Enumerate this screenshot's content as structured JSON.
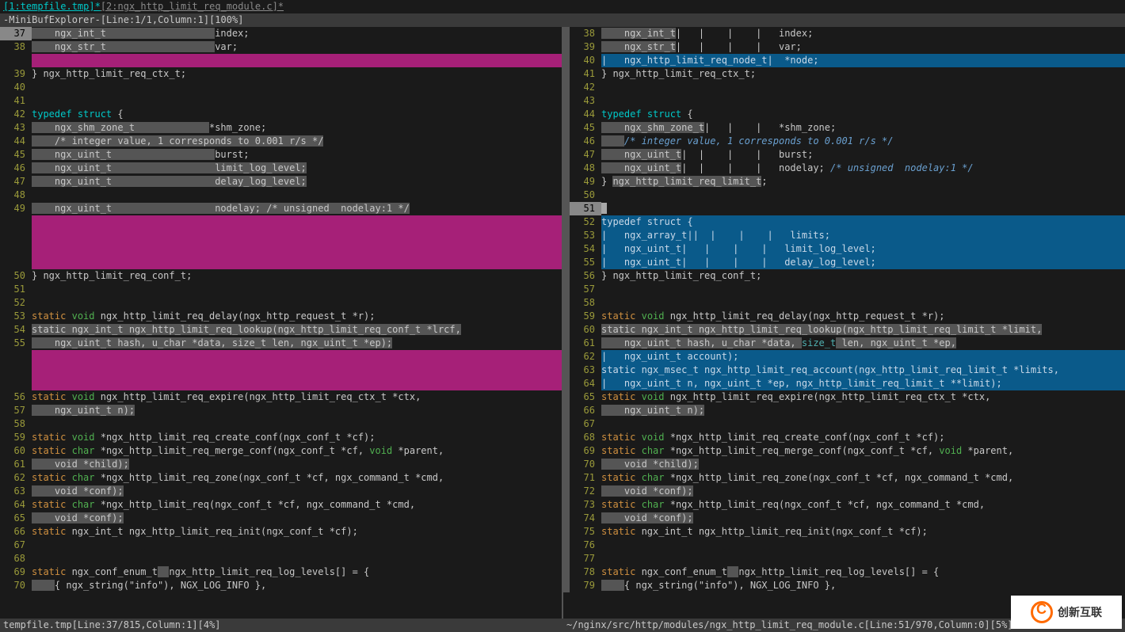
{
  "tabline": {
    "tab1": "[1:tempfile.tmp]*",
    "tab2": "[2:ngx_http_limit_req_module.c]*"
  },
  "minibuf": "-MiniBufExplorer-[Line:1/1,Column:1][100%]",
  "status_left": "tempfile.tmp[Line:37/815,Column:1][4%]",
  "status_right": "~/nginx/src/http/modules/ngx_http_limit_req_module.c[Line:51/970,Column:0][5%]",
  "logo_text": "创新互联",
  "left": [
    {
      "n": "37",
      "cls": "cur",
      "seg": [
        {
          "t": "    ngx_int_t                   ",
          "c": "hl-gray"
        },
        {
          "t": "index;",
          "c": ""
        }
      ]
    },
    {
      "n": "38",
      "seg": [
        {
          "t": "    ngx_str_t                   ",
          "c": "hl-gray"
        },
        {
          "t": "var;",
          "c": ""
        }
      ]
    },
    {
      "n": "",
      "mag": true
    },
    {
      "n": "39",
      "seg": [
        {
          "t": "} ngx_http_limit_req_ctx_t;",
          "c": ""
        }
      ]
    },
    {
      "n": "40",
      "seg": [
        {
          "t": "",
          "c": ""
        }
      ]
    },
    {
      "n": "41",
      "seg": [
        {
          "t": "",
          "c": ""
        }
      ]
    },
    {
      "n": "42",
      "seg": [
        {
          "t": "typedef",
          "c": "hl-kw"
        },
        {
          "t": " ",
          "c": ""
        },
        {
          "t": "struct",
          "c": "hl-kw"
        },
        {
          "t": " {",
          "c": ""
        }
      ]
    },
    {
      "n": "43",
      "seg": [
        {
          "t": "    ngx_shm_zone_t             ",
          "c": "hl-gray"
        },
        {
          "t": "*shm_zone;",
          "c": ""
        }
      ]
    },
    {
      "n": "44",
      "seg": [
        {
          "t": "    /* integer value, 1 corresponds to 0.001 r/s */",
          "c": "hl-gray"
        }
      ]
    },
    {
      "n": "45",
      "seg": [
        {
          "t": "    ngx_uint_t                  ",
          "c": "hl-gray"
        },
        {
          "t": "burst;",
          "c": ""
        }
      ]
    },
    {
      "n": "46",
      "seg": [
        {
          "t": "    ngx_uint_t                  limit_log_level;",
          "c": "hl-gray"
        }
      ]
    },
    {
      "n": "47",
      "seg": [
        {
          "t": "    ngx_uint_t                  delay_log_level;",
          "c": "hl-gray"
        }
      ]
    },
    {
      "n": "48",
      "seg": [
        {
          "t": "",
          "c": ""
        }
      ]
    },
    {
      "n": "49",
      "seg": [
        {
          "t": "    ngx_uint_t                  nodelay; /* unsigned  nodelay:1 */",
          "c": "hl-gray"
        }
      ]
    },
    {
      "n": "",
      "mag": true
    },
    {
      "n": "",
      "mag": true
    },
    {
      "n": "",
      "mag": true
    },
    {
      "n": "",
      "mag": true
    },
    {
      "n": "50",
      "seg": [
        {
          "t": "} ngx_http_limit_req_conf_t;",
          "c": ""
        }
      ]
    },
    {
      "n": "51",
      "seg": [
        {
          "t": "",
          "c": ""
        }
      ]
    },
    {
      "n": "52",
      "seg": [
        {
          "t": "",
          "c": ""
        }
      ]
    },
    {
      "n": "53",
      "seg": [
        {
          "t": "static",
          "c": "hl-stat"
        },
        {
          "t": " ",
          "c": ""
        },
        {
          "t": "void",
          "c": "hl-void"
        },
        {
          "t": " ngx_http_limit_req_delay(ngx_http_request_t *r);",
          "c": ""
        }
      ]
    },
    {
      "n": "54",
      "seg": [
        {
          "t": "static ngx_int_t ngx_http_limit_req_lookup(ngx_http_limit_req_",
          "c": "hl-gray"
        },
        {
          "t": "conf_t *lrcf,",
          "c": "hl-gray"
        }
      ]
    },
    {
      "n": "55",
      "seg": [
        {
          "t": "    ngx_uint_t hash, u_char *data, size_t len, ngx_uint_t *ep);",
          "c": "hl-gray"
        }
      ]
    },
    {
      "n": "",
      "mag": true
    },
    {
      "n": "",
      "mag": true
    },
    {
      "n": "",
      "mag": true
    },
    {
      "n": "56",
      "seg": [
        {
          "t": "static",
          "c": "hl-stat"
        },
        {
          "t": " ",
          "c": ""
        },
        {
          "t": "void",
          "c": "hl-void"
        },
        {
          "t": " ngx_http_limit_req_expire(ngx_http_limit_req_ctx_t *ctx,",
          "c": ""
        }
      ]
    },
    {
      "n": "57",
      "seg": [
        {
          "t": "    ngx_uint_t n);",
          "c": "hl-gray"
        }
      ]
    },
    {
      "n": "58",
      "seg": [
        {
          "t": "",
          "c": ""
        }
      ]
    },
    {
      "n": "59",
      "seg": [
        {
          "t": "static",
          "c": "hl-stat"
        },
        {
          "t": " ",
          "c": ""
        },
        {
          "t": "void",
          "c": "hl-void"
        },
        {
          "t": " *ngx_http_limit_req_create_conf(ngx_conf_t *cf);",
          "c": ""
        }
      ]
    },
    {
      "n": "60",
      "seg": [
        {
          "t": "static",
          "c": "hl-stat"
        },
        {
          "t": " ",
          "c": ""
        },
        {
          "t": "char",
          "c": "hl-void"
        },
        {
          "t": " *ngx_http_limit_req_merge_conf(ngx_conf_t *cf, ",
          "c": ""
        },
        {
          "t": "void",
          "c": "hl-void"
        },
        {
          "t": " *parent,",
          "c": ""
        }
      ]
    },
    {
      "n": "61",
      "seg": [
        {
          "t": "    void *child);",
          "c": "hl-gray"
        }
      ]
    },
    {
      "n": "62",
      "seg": [
        {
          "t": "static",
          "c": "hl-stat"
        },
        {
          "t": " ",
          "c": ""
        },
        {
          "t": "char",
          "c": "hl-void"
        },
        {
          "t": " *ngx_http_limit_req_zone(ngx_conf_t *cf, ngx_command_t *cmd,",
          "c": ""
        }
      ]
    },
    {
      "n": "63",
      "seg": [
        {
          "t": "    void *conf);",
          "c": "hl-gray"
        }
      ]
    },
    {
      "n": "64",
      "seg": [
        {
          "t": "static",
          "c": "hl-stat"
        },
        {
          "t": " ",
          "c": ""
        },
        {
          "t": "char",
          "c": "hl-void"
        },
        {
          "t": " *ngx_http_limit_req(ngx_conf_t *cf, ngx_command_t *cmd,",
          "c": ""
        }
      ]
    },
    {
      "n": "65",
      "seg": [
        {
          "t": "    void *conf);",
          "c": "hl-gray"
        }
      ]
    },
    {
      "n": "66",
      "seg": [
        {
          "t": "static",
          "c": "hl-stat"
        },
        {
          "t": " ngx_int_t ngx_http_limit_req_init(ngx_conf_t *cf);",
          "c": ""
        }
      ]
    },
    {
      "n": "67",
      "seg": [
        {
          "t": "",
          "c": ""
        }
      ]
    },
    {
      "n": "68",
      "seg": [
        {
          "t": "",
          "c": ""
        }
      ]
    },
    {
      "n": "69",
      "seg": [
        {
          "t": "static",
          "c": "hl-stat"
        },
        {
          "t": " ngx_conf_enum_t",
          "c": ""
        },
        {
          "t": "  ",
          "c": "hl-gray"
        },
        {
          "t": "ngx_http_limit_req_log_levels[] = {",
          "c": ""
        }
      ]
    },
    {
      "n": "70",
      "seg": [
        {
          "t": "    ",
          "c": "hl-gray"
        },
        {
          "t": "{ ngx_string(\"info\"), NGX_LOG_INFO },",
          "c": ""
        }
      ]
    }
  ],
  "right": [
    {
      "n": "38",
      "seg": [
        {
          "t": "    ngx_int_t",
          "c": "hl-gray"
        },
        {
          "t": "|   |    |    |",
          "c": ""
        },
        {
          "t": "   index;",
          "c": ""
        }
      ]
    },
    {
      "n": "39",
      "seg": [
        {
          "t": "    ngx_str_t",
          "c": "hl-gray"
        },
        {
          "t": "|   |    |    |",
          "c": ""
        },
        {
          "t": "   var;",
          "c": ""
        }
      ]
    },
    {
      "n": "40",
      "seg": [
        {
          "t": "|   ngx_http_limit_req_node_t|  *node;",
          "c": "hl-blue"
        }
      ]
    },
    {
      "n": "41",
      "seg": [
        {
          "t": "} ngx_http_limit_req_ctx_t;",
          "c": ""
        }
      ]
    },
    {
      "n": "42",
      "seg": [
        {
          "t": "",
          "c": ""
        }
      ]
    },
    {
      "n": "43",
      "seg": [
        {
          "t": "",
          "c": ""
        }
      ]
    },
    {
      "n": "44",
      "seg": [
        {
          "t": "typedef",
          "c": "hl-kw"
        },
        {
          "t": " ",
          "c": ""
        },
        {
          "t": "struct",
          "c": "hl-kw"
        },
        {
          "t": " {",
          "c": ""
        }
      ]
    },
    {
      "n": "45",
      "seg": [
        {
          "t": "    ngx_shm_zone_t",
          "c": "hl-gray"
        },
        {
          "t": "|   |    | ",
          "c": ""
        },
        {
          "t": "  *shm_zone;",
          "c": ""
        }
      ]
    },
    {
      "n": "46",
      "seg": [
        {
          "t": "    ",
          "c": "hl-gray"
        },
        {
          "t": "/* integer value, 1 corresponds to 0.001 r/s */",
          "c": "hl-comment"
        }
      ]
    },
    {
      "n": "47",
      "seg": [
        {
          "t": "    ngx_uint_t",
          "c": "hl-gray"
        },
        {
          "t": "|  |    |    | ",
          "c": ""
        },
        {
          "t": "  burst;",
          "c": ""
        }
      ]
    },
    {
      "n": "48",
      "seg": [
        {
          "t": "    ngx_uint_t",
          "c": "hl-gray"
        },
        {
          "t": "|  |    |    | ",
          "c": ""
        },
        {
          "t": "  nodelay; ",
          "c": ""
        },
        {
          "t": "/* unsigned  nodelay:1 */",
          "c": "hl-comment"
        }
      ]
    },
    {
      "n": "49",
      "seg": [
        {
          "t": "} ",
          "c": ""
        },
        {
          "t": "ngx_http_limit_req_limit_t",
          "c": "hl-gray"
        },
        {
          "t": ";",
          "c": ""
        }
      ]
    },
    {
      "n": "50",
      "seg": [
        {
          "t": "",
          "c": ""
        }
      ]
    },
    {
      "n": "51",
      "cls": "cur",
      "cursor": true,
      "seg": [
        {
          "t": "",
          "c": ""
        }
      ]
    },
    {
      "n": "52",
      "seg": [
        {
          "t": "typedef struct {",
          "c": "hl-blue"
        }
      ]
    },
    {
      "n": "53",
      "seg": [
        {
          "t": "|   ngx_array_t||  |    |    |   limits;",
          "c": "hl-blue"
        }
      ]
    },
    {
      "n": "54",
      "seg": [
        {
          "t": "|   ngx_uint_t|   |    |    |   limit_log_level;",
          "c": "hl-blue"
        }
      ]
    },
    {
      "n": "55",
      "seg": [
        {
          "t": "|   ngx_uint_t|   |    |    |   delay_log_level;",
          "c": "hl-blue"
        }
      ]
    },
    {
      "n": "56",
      "seg": [
        {
          "t": "} ngx_http_limit_req_conf_t;",
          "c": ""
        }
      ]
    },
    {
      "n": "57",
      "seg": [
        {
          "t": "",
          "c": ""
        }
      ]
    },
    {
      "n": "58",
      "seg": [
        {
          "t": "",
          "c": ""
        }
      ]
    },
    {
      "n": "59",
      "seg": [
        {
          "t": "static",
          "c": "hl-stat"
        },
        {
          "t": " ",
          "c": ""
        },
        {
          "t": "void",
          "c": "hl-void"
        },
        {
          "t": " ngx_http_limit_req_delay(ngx_http_request_t *r);",
          "c": ""
        }
      ]
    },
    {
      "n": "60",
      "seg": [
        {
          "t": "static ngx_int_t ngx_http_limit_req_lookup(ngx_http_limit_req_",
          "c": "hl-gray"
        },
        {
          "t": "limit_t *limit,",
          "c": "hl-gray"
        }
      ]
    },
    {
      "n": "61",
      "seg": [
        {
          "t": "    ngx_uint_t hash, u_char *data, ",
          "c": "hl-gray"
        },
        {
          "t": "size_t",
          "c": "hl-type"
        },
        {
          "t": " len, ngx_uint_t *ep,",
          "c": "hl-gray"
        }
      ]
    },
    {
      "n": "62",
      "seg": [
        {
          "t": "|   ngx_uint_t account);",
          "c": "hl-blue"
        }
      ]
    },
    {
      "n": "63",
      "seg": [
        {
          "t": "static ngx_msec_t ngx_http_limit_req_account(ngx_http_limit_req_limit_t *limits,",
          "c": "hl-blue"
        }
      ]
    },
    {
      "n": "64",
      "seg": [
        {
          "t": "|   ngx_uint_t n, ngx_uint_t *ep, ngx_http_limit_req_limit_t **limit);",
          "c": "hl-blue"
        }
      ]
    },
    {
      "n": "65",
      "seg": [
        {
          "t": "static",
          "c": "hl-stat"
        },
        {
          "t": " ",
          "c": ""
        },
        {
          "t": "void",
          "c": "hl-void"
        },
        {
          "t": " ngx_http_limit_req_expire(ngx_http_limit_req_ctx_t *ctx,",
          "c": ""
        }
      ]
    },
    {
      "n": "66",
      "seg": [
        {
          "t": "    ngx_uint_t n);",
          "c": "hl-gray"
        }
      ]
    },
    {
      "n": "67",
      "seg": [
        {
          "t": "",
          "c": ""
        }
      ]
    },
    {
      "n": "68",
      "seg": [
        {
          "t": "static",
          "c": "hl-stat"
        },
        {
          "t": " ",
          "c": ""
        },
        {
          "t": "void",
          "c": "hl-void"
        },
        {
          "t": " *ngx_http_limit_req_create_conf(ngx_conf_t *cf);",
          "c": ""
        }
      ]
    },
    {
      "n": "69",
      "seg": [
        {
          "t": "static",
          "c": "hl-stat"
        },
        {
          "t": " ",
          "c": ""
        },
        {
          "t": "char",
          "c": "hl-void"
        },
        {
          "t": " *ngx_http_limit_req_merge_conf(ngx_conf_t *cf, ",
          "c": ""
        },
        {
          "t": "void",
          "c": "hl-void"
        },
        {
          "t": " *parent,",
          "c": ""
        }
      ]
    },
    {
      "n": "70",
      "seg": [
        {
          "t": "    void *child);",
          "c": "hl-gray"
        }
      ]
    },
    {
      "n": "71",
      "seg": [
        {
          "t": "static",
          "c": "hl-stat"
        },
        {
          "t": " ",
          "c": ""
        },
        {
          "t": "char",
          "c": "hl-void"
        },
        {
          "t": " *ngx_http_limit_req_zone(ngx_conf_t *cf, ngx_command_t *cmd,",
          "c": ""
        }
      ]
    },
    {
      "n": "72",
      "seg": [
        {
          "t": "    void *conf);",
          "c": "hl-gray"
        }
      ]
    },
    {
      "n": "73",
      "seg": [
        {
          "t": "static",
          "c": "hl-stat"
        },
        {
          "t": " ",
          "c": ""
        },
        {
          "t": "char",
          "c": "hl-void"
        },
        {
          "t": " *ngx_http_limit_req(ngx_conf_t *cf, ngx_command_t *cmd,",
          "c": ""
        }
      ]
    },
    {
      "n": "74",
      "seg": [
        {
          "t": "    void *conf);",
          "c": "hl-gray"
        }
      ]
    },
    {
      "n": "75",
      "seg": [
        {
          "t": "static",
          "c": "hl-stat"
        },
        {
          "t": " ngx_int_t ngx_http_limit_req_init(ngx_conf_t *cf);",
          "c": ""
        }
      ]
    },
    {
      "n": "76",
      "seg": [
        {
          "t": "",
          "c": ""
        }
      ]
    },
    {
      "n": "77",
      "seg": [
        {
          "t": "",
          "c": ""
        }
      ]
    },
    {
      "n": "78",
      "seg": [
        {
          "t": "static",
          "c": "hl-stat"
        },
        {
          "t": " ngx_conf_enum_t",
          "c": ""
        },
        {
          "t": "  ",
          "c": "hl-gray"
        },
        {
          "t": "ngx_http_limit_req_log_levels[] = {",
          "c": ""
        }
      ]
    },
    {
      "n": "79",
      "seg": [
        {
          "t": "    ",
          "c": "hl-gray"
        },
        {
          "t": "{ ngx_string(\"info\"), NGX_LOG_INFO },",
          "c": ""
        }
      ]
    }
  ]
}
